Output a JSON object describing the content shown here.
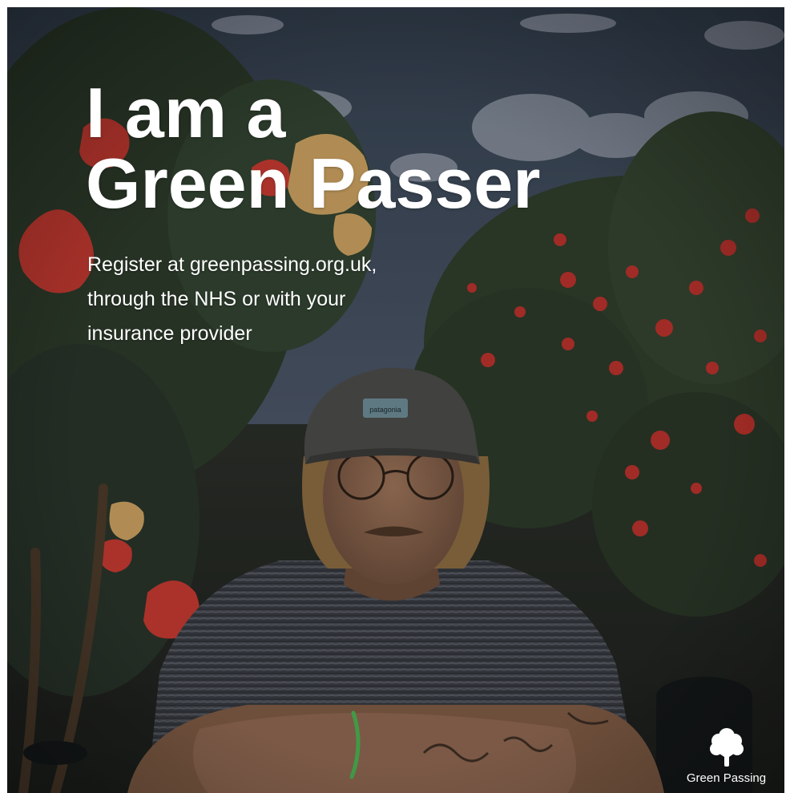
{
  "poster": {
    "headline_line1": "I am a",
    "headline_line2": "Green Passer",
    "subtitle_line1": "Register at greenpassing.org.uk,",
    "subtitle_line2": "through the NHS or with your",
    "subtitle_line3": "insurance provider"
  },
  "brand": {
    "name": "Green Passing",
    "logo_icon": "tree-icon"
  },
  "photo": {
    "icon": "portrait-photo",
    "cap_text": "patagonia"
  },
  "colors": {
    "text": "#ffffff",
    "sky": "#3f4a5a",
    "foliage": "#2f3a2a",
    "flower_red": "#b8322c",
    "flower_yellow": "#c9a060",
    "shirt": "#3a3e44",
    "skin": "#8a6650",
    "bracelet": "#4caf50"
  }
}
